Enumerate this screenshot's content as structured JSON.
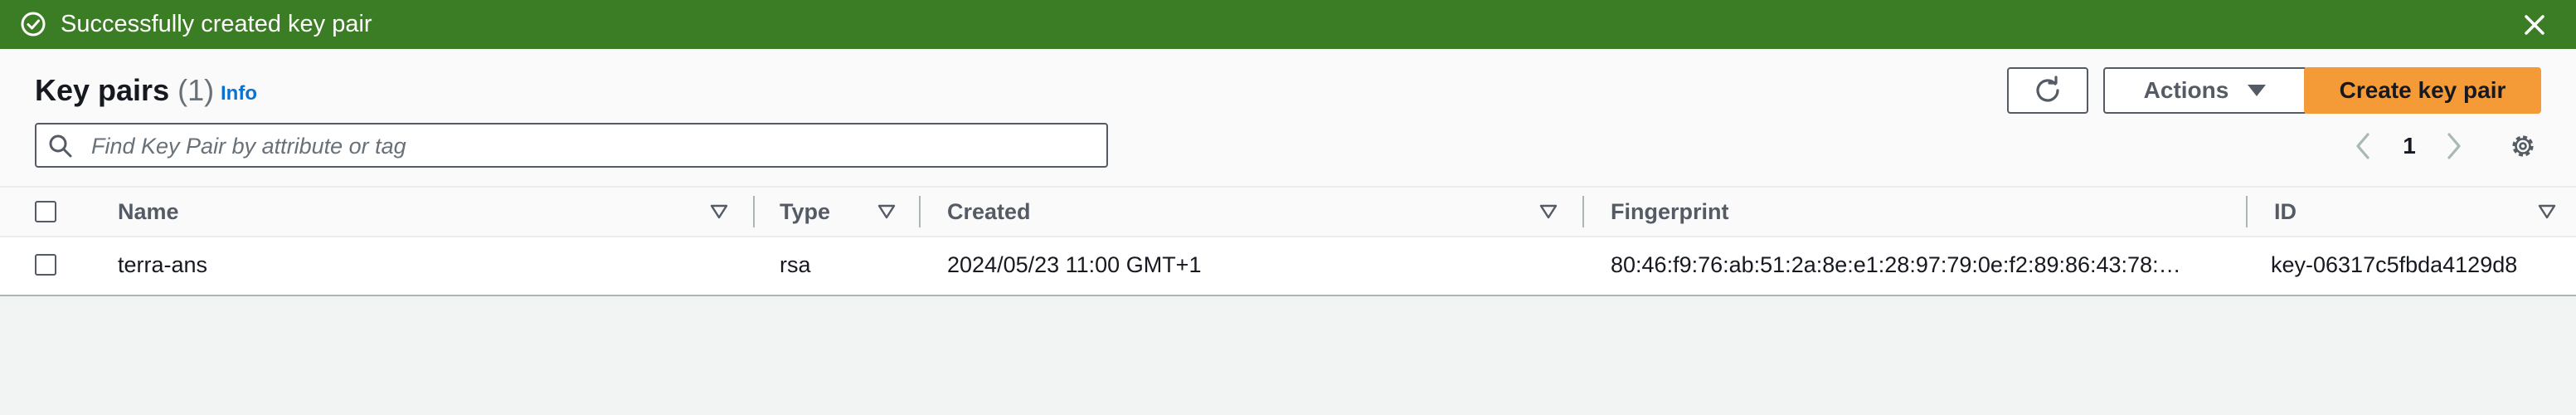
{
  "flash": {
    "message": "Successfully created key pair",
    "color": "#3b7d24",
    "icons": {
      "status": "check-circle-icon",
      "dismiss": "close-icon"
    }
  },
  "header": {
    "title": "Key pairs",
    "count": "(1)",
    "info_link": "Info"
  },
  "toolbar": {
    "refresh_icon": "refresh-icon",
    "actions_label": "Actions",
    "create_label": "Create key pair",
    "create_color": "#f49a37"
  },
  "search": {
    "placeholder": "Find Key Pair by attribute or tag",
    "value": ""
  },
  "pagination": {
    "current_page": "1"
  },
  "table": {
    "columns": [
      "Name",
      "Type",
      "Created",
      "Fingerprint",
      "ID"
    ],
    "rows": [
      {
        "name": "terra-ans",
        "type": "rsa",
        "created": "2024/05/23 11:00 GMT+1",
        "fingerprint": "80:46:f9:76:ab:51:2a:8e:e1:28:97:79:0e:f2:89:86:43:78:…",
        "id": "key-06317c5fbda4129d8"
      }
    ]
  }
}
